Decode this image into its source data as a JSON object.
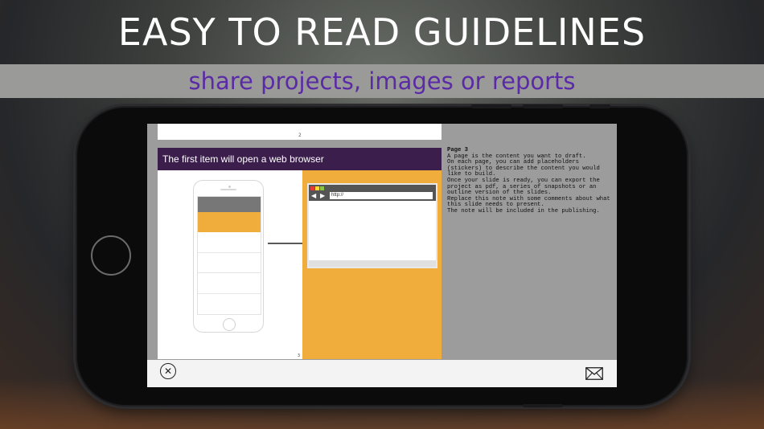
{
  "headline": "EASY TO READ GUIDELINES",
  "subheadline": "share projects, images or reports",
  "colors": {
    "subheadline_text": "#5b2aa6",
    "slide_title_bg": "#3b1e4c",
    "accent_orange": "#f1ad3c"
  },
  "document": {
    "previous_page_number": "2",
    "slide": {
      "title": "The first item will open a web browser",
      "browser_url": "http://",
      "back_icon": "◀",
      "forward_icon": "▶",
      "page_number": "3"
    },
    "notes": {
      "title": "Page 3",
      "lines": [
        "A page is the content you want to draft.",
        "On each page, you can add placeholders",
        "(stickers) to describe the content you would",
        "like to build.",
        "Once your slide is ready, you can export the",
        "project as pdf, a series of snapshots or an",
        "outline version of the slides.",
        "Replace this note with some comments about what",
        "this slide needs to present.",
        "The note will be included in the publishing."
      ]
    }
  },
  "toolbar": {
    "close_icon": "close-circle-icon",
    "close_glyph": "✕",
    "mail_icon": "envelope-icon"
  }
}
